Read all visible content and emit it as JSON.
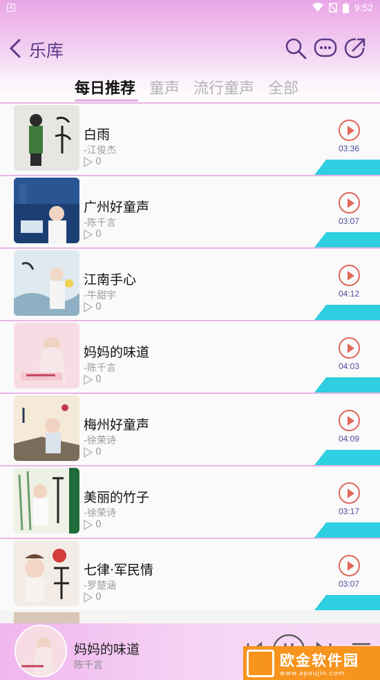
{
  "status_bar": {
    "time": "9:52",
    "app_icon": "A"
  },
  "header": {
    "title": "乐库",
    "icons": [
      "back-icon",
      "search-icon",
      "message-icon",
      "share-icon"
    ]
  },
  "tabs": [
    {
      "label": "每日推荐",
      "active": true
    },
    {
      "label": "童声",
      "active": false
    },
    {
      "label": "流行童声",
      "active": false
    },
    {
      "label": "全部",
      "active": false
    }
  ],
  "songs": [
    {
      "title": "白雨",
      "artist": "-江俊杰",
      "plays": "0",
      "duration": "03:36"
    },
    {
      "title": "广州好童声",
      "artist": "-陈千言",
      "plays": "0",
      "duration": "03:07"
    },
    {
      "title": "江南手心",
      "artist": "-牛甜宇",
      "plays": "0",
      "duration": "04:12"
    },
    {
      "title": "妈妈的味道",
      "artist": "-陈千言",
      "plays": "0",
      "duration": "04:03"
    },
    {
      "title": "梅州好童声",
      "artist": "-徐荣诗",
      "plays": "0",
      "duration": "04:09"
    },
    {
      "title": "美丽的竹子",
      "artist": "-徐荣诗",
      "plays": "0",
      "duration": "03:17"
    },
    {
      "title": "七律·军民情",
      "artist": "-罗楚涵",
      "plays": "0",
      "duration": "03:07"
    }
  ],
  "now_playing": {
    "title": "妈妈的味道",
    "artist": "陈千言"
  },
  "watermark": {
    "main": "欧金软件园",
    "sub": "www.apoujin.com"
  },
  "colors": {
    "accent_cyan": "#2ecfe0",
    "play_red": "#e0665a",
    "header_pink": "#e9a6e6",
    "title_purple": "#5a3a86"
  }
}
